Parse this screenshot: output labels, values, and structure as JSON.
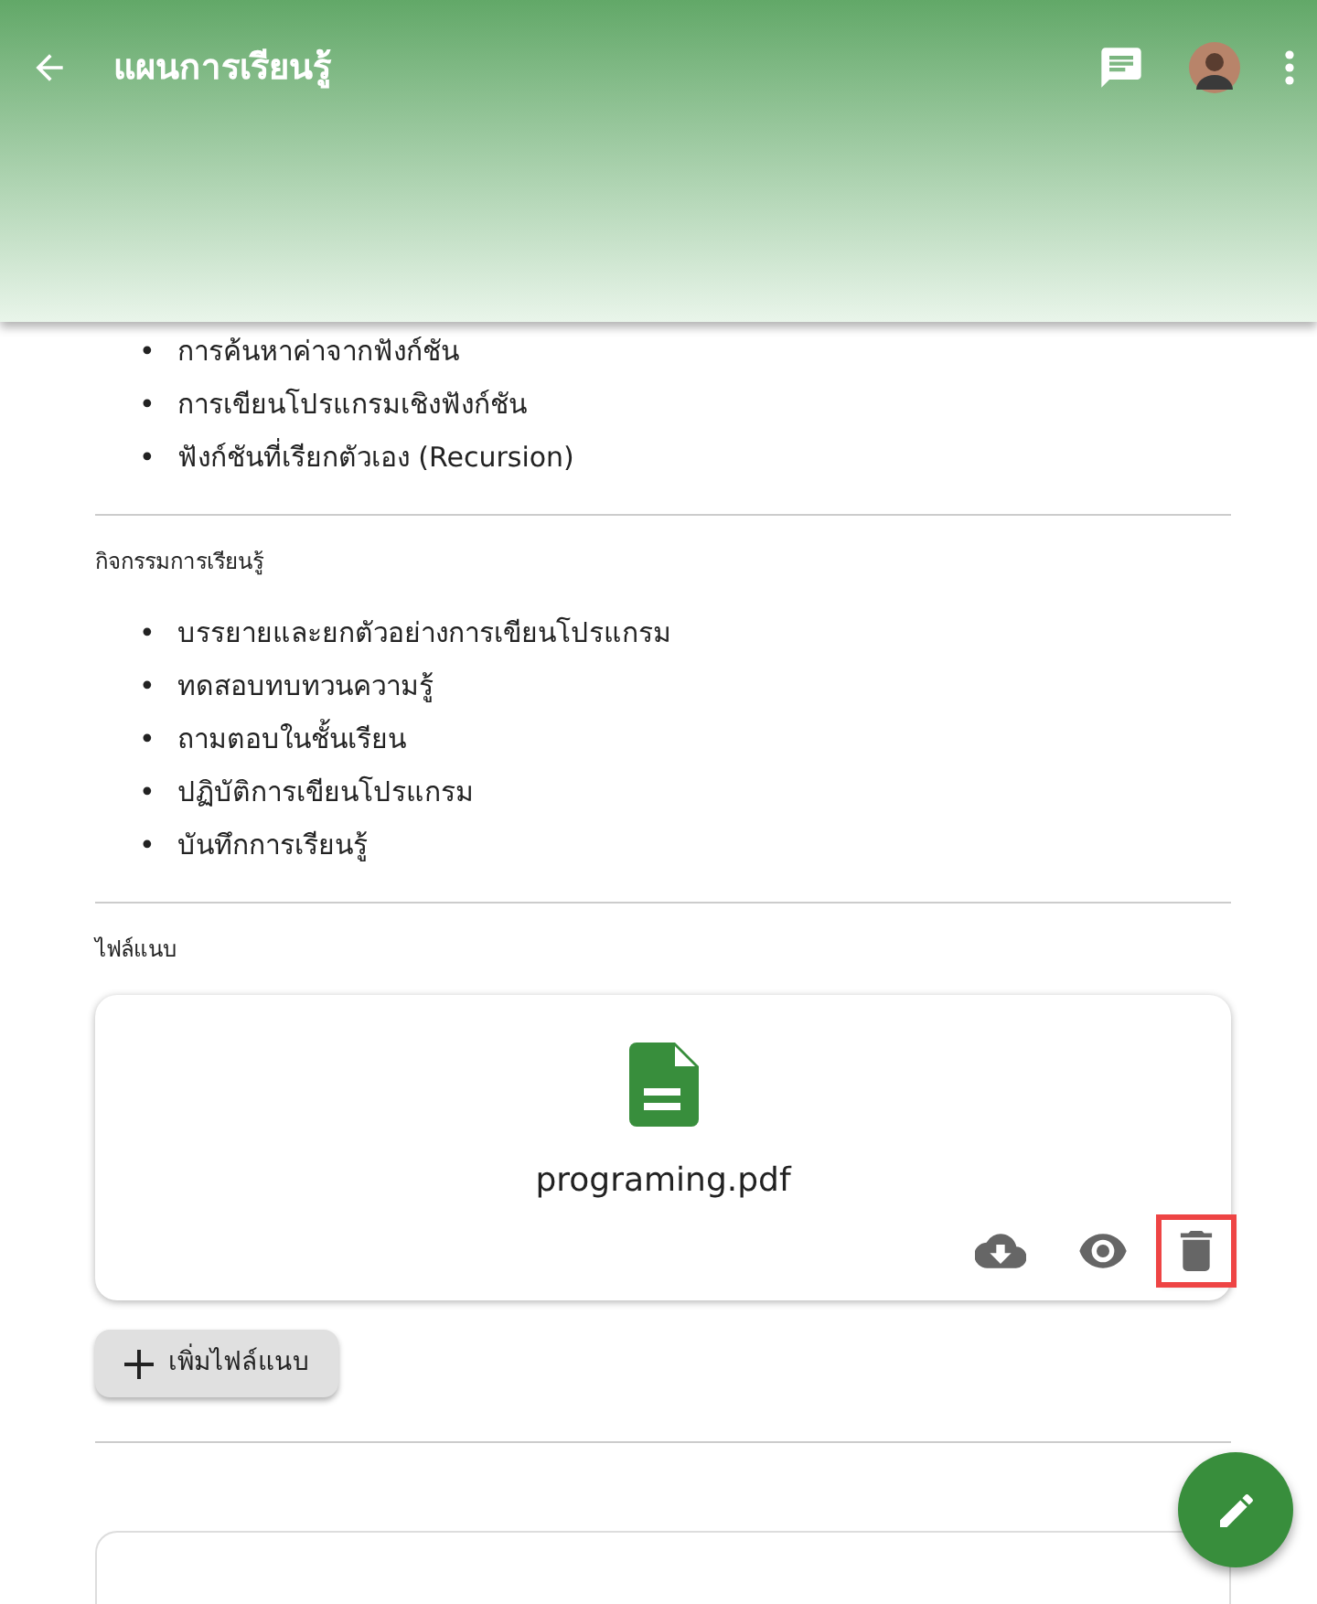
{
  "app_bar": {
    "title": "แผนการเรียนรู้"
  },
  "bullet": "•",
  "topics": [
    "การค้นหาค่าจากฟังก์ชัน",
    "การเขียนโปรแกรมเชิงฟังก์ชัน",
    "ฟังก์ชันที่เรียกตัวเอง (Recursion)"
  ],
  "activities": {
    "label": "กิจกรรมการเรียนรู้",
    "items": [
      "บรรยายและยกตัวอย่างการเขียนโปรแกรม",
      "ทดสอบทบทวนความรู้",
      "ถามตอบในชั้นเรียน",
      "ปฏิบัติการเขียนโปรแกรม",
      "บันทึกการเรียนรู้"
    ]
  },
  "attachments": {
    "label": "ไฟล์แนบ",
    "files": [
      {
        "name": "programing.pdf",
        "actions": [
          {
            "kind": "download",
            "highlighted": false
          },
          {
            "kind": "view",
            "highlighted": false
          },
          {
            "kind": "delete",
            "highlighted": true
          }
        ]
      }
    ],
    "add_button": "เพิ่มไฟล์แนบ"
  }
}
